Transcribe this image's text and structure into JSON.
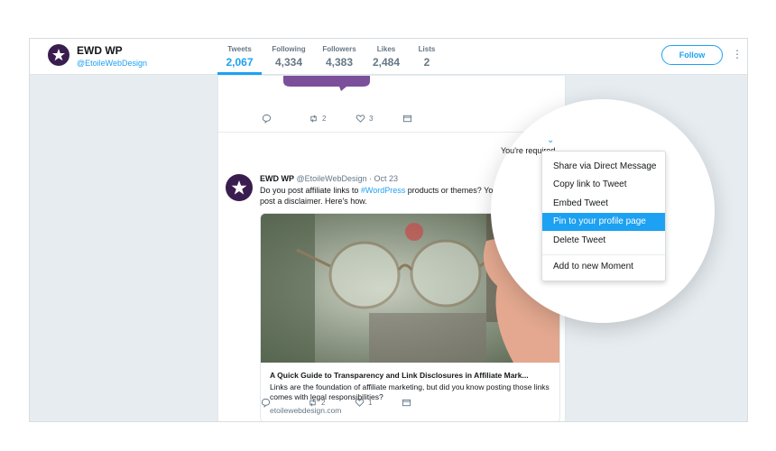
{
  "profile": {
    "name": "EWD WP",
    "handle": "@EtoileWebDesign",
    "follow_label": "Follow"
  },
  "stats": [
    {
      "label": "Tweets",
      "value": "2,067"
    },
    {
      "label": "Following",
      "value": "4,334"
    },
    {
      "label": "Followers",
      "value": "4,383"
    },
    {
      "label": "Likes",
      "value": "2,484"
    },
    {
      "label": "Lists",
      "value": "2"
    }
  ],
  "prev_tweet_actions": {
    "retweets": "2",
    "likes": "3"
  },
  "tweet": {
    "name": "EWD WP",
    "handle_date": "@EtoileWebDesign · Oct 23",
    "text_before": "Do you post affiliate links to ",
    "hashtag": "#WordPress",
    "text_after": " products or themes? You're required to",
    "text_line2": "post a disclaimer. Here's how.",
    "card_title": "A Quick Guide to Transparency and Link Disclosures in Affiliate Mark...",
    "card_desc": "Links are the foundation of affiliate marketing, but did you know posting those links comes with legal responsibilities?",
    "card_domain": "etoilewebdesign.com",
    "retweets": "2",
    "likes": "1"
  },
  "lens_text": "You're required",
  "menu": {
    "items": [
      "Share via Direct Message",
      "Copy link to Tweet",
      "Embed Tweet",
      "Pin to your profile page",
      "Delete Tweet",
      "Add to new Moment"
    ],
    "highlighted_index": 3
  },
  "colors": {
    "accent": "#1da1f2",
    "avatar": "#3a1d4f"
  }
}
